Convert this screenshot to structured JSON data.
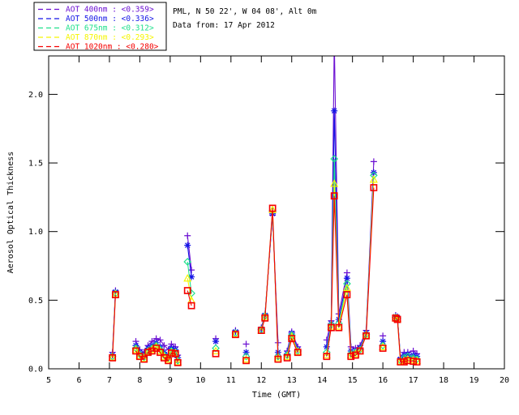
{
  "header": {
    "station_line": "PML, N 50 22', W 04 08', Alt 0m",
    "date_line": "Data from: 17 Apr 2012"
  },
  "legend": {
    "entries": [
      {
        "label": "AOT  400nm : <0.359>",
        "color": "#6B0FD2"
      },
      {
        "label": "AOT  500nm : <0.336>",
        "color": "#1515E6"
      },
      {
        "label": "AOT  675nm : <0.312>",
        "color": "#1FE08C"
      },
      {
        "label": "AOT  870nm : <0.293>",
        "color": "#F5F500"
      },
      {
        "label": "AOT 1020nm : <0.280>",
        "color": "#F50000"
      }
    ]
  },
  "chart_data": {
    "type": "line",
    "title": "PML, N 50 22', W 04 08', Alt 0m",
    "subtitle": "Data from: 17 Apr 2012",
    "xlabel": "Time (GMT)",
    "ylabel": "Aerosol Optical Thickness",
    "xlim": [
      5,
      20
    ],
    "ylim": [
      0,
      2.28
    ],
    "xticks": [
      5,
      6,
      7,
      8,
      9,
      10,
      11,
      12,
      13,
      14,
      15,
      16,
      17,
      18,
      19,
      20
    ],
    "yticks": [
      0.0,
      0.5,
      1.0,
      1.5,
      2.0
    ],
    "ytick_labels": [
      "0.0",
      "0.5",
      "1.0",
      "1.5",
      "2.0"
    ],
    "grid": false,
    "legend_position": "top-left",
    "gap_threshold_hours": 0.28,
    "x": [
      7.1,
      7.2,
      7.87,
      8.0,
      8.14,
      8.27,
      8.4,
      8.54,
      8.67,
      8.8,
      8.94,
      9.04,
      9.17,
      9.25,
      9.57,
      9.7,
      10.5,
      11.15,
      11.5,
      12.0,
      12.12,
      12.37,
      12.55,
      12.85,
      13.0,
      13.2,
      14.15,
      14.3,
      14.4,
      14.55,
      14.82,
      14.95,
      15.1,
      15.25,
      15.45,
      15.7,
      16.0,
      16.42,
      16.48,
      16.58,
      16.7,
      16.82,
      17.0,
      17.12
    ],
    "series": [
      {
        "name": "AOT  400nm",
        "daily_mean": "<0.359>",
        "color": "#6B0FD2",
        "symbol": "plus",
        "values": [
          0.12,
          0.57,
          0.2,
          0.14,
          0.12,
          0.17,
          0.2,
          0.22,
          0.21,
          0.17,
          0.14,
          0.18,
          0.16,
          0.1,
          0.97,
          0.72,
          0.22,
          0.28,
          0.18,
          0.3,
          0.4,
          1.12,
          0.19,
          0.13,
          0.27,
          0.16,
          0.21,
          0.35,
          2.4,
          0.4,
          0.7,
          0.16,
          0.15,
          0.17,
          0.28,
          1.51,
          0.24,
          0.39,
          0.38,
          0.08,
          0.12,
          0.12,
          0.13,
          0.11
        ]
      },
      {
        "name": "AOT  500nm",
        "daily_mean": "<0.336>",
        "color": "#1515E6",
        "symbol": "asterisk",
        "values": [
          0.1,
          0.56,
          0.17,
          0.12,
          0.1,
          0.15,
          0.17,
          0.19,
          0.16,
          0.12,
          0.1,
          0.15,
          0.14,
          0.08,
          0.9,
          0.67,
          0.2,
          0.27,
          0.12,
          0.29,
          0.39,
          1.13,
          0.12,
          0.11,
          0.26,
          0.14,
          0.16,
          0.33,
          1.88,
          0.36,
          0.66,
          0.13,
          0.13,
          0.15,
          0.26,
          1.43,
          0.2,
          0.38,
          0.375,
          0.07,
          0.1,
          0.105,
          0.1,
          0.09
        ]
      },
      {
        "name": "AOT  675nm",
        "daily_mean": "<0.312>",
        "color": "#1FE08C",
        "symbol": "diamond",
        "values": [
          0.09,
          0.55,
          0.15,
          0.105,
          0.085,
          0.13,
          0.15,
          0.17,
          0.14,
          0.1,
          0.08,
          0.13,
          0.12,
          0.06,
          0.78,
          0.55,
          0.15,
          0.26,
          0.09,
          0.285,
          0.385,
          1.15,
          0.09,
          0.1,
          0.245,
          0.13,
          0.12,
          0.32,
          1.53,
          0.33,
          0.62,
          0.11,
          0.12,
          0.14,
          0.25,
          1.41,
          0.17,
          0.375,
          0.37,
          0.06,
          0.08,
          0.09,
          0.08,
          0.07
        ]
      },
      {
        "name": "AOT  870nm",
        "daily_mean": "<0.293>",
        "color": "#F5F500",
        "symbol": "triangle",
        "values": [
          0.085,
          0.545,
          0.14,
          0.095,
          0.075,
          0.125,
          0.14,
          0.16,
          0.13,
          0.09,
          0.07,
          0.12,
          0.115,
          0.05,
          0.66,
          0.5,
          0.13,
          0.255,
          0.07,
          0.28,
          0.38,
          1.16,
          0.08,
          0.09,
          0.235,
          0.125,
          0.1,
          0.31,
          1.35,
          0.31,
          0.59,
          0.1,
          0.11,
          0.13,
          0.245,
          1.38,
          0.16,
          0.37,
          0.365,
          0.055,
          0.06,
          0.07,
          0.065,
          0.06
        ]
      },
      {
        "name": "AOT 1020nm",
        "daily_mean": "<0.280>",
        "color": "#F50000",
        "symbol": "square",
        "values": [
          0.08,
          0.54,
          0.13,
          0.09,
          0.07,
          0.12,
          0.13,
          0.15,
          0.12,
          0.08,
          0.06,
          0.115,
          0.11,
          0.045,
          0.57,
          0.46,
          0.11,
          0.25,
          0.06,
          0.28,
          0.37,
          1.17,
          0.07,
          0.08,
          0.22,
          0.12,
          0.09,
          0.3,
          1.26,
          0.3,
          0.54,
          0.09,
          0.1,
          0.13,
          0.24,
          1.32,
          0.15,
          0.37,
          0.36,
          0.05,
          0.05,
          0.06,
          0.055,
          0.05
        ]
      }
    ]
  }
}
